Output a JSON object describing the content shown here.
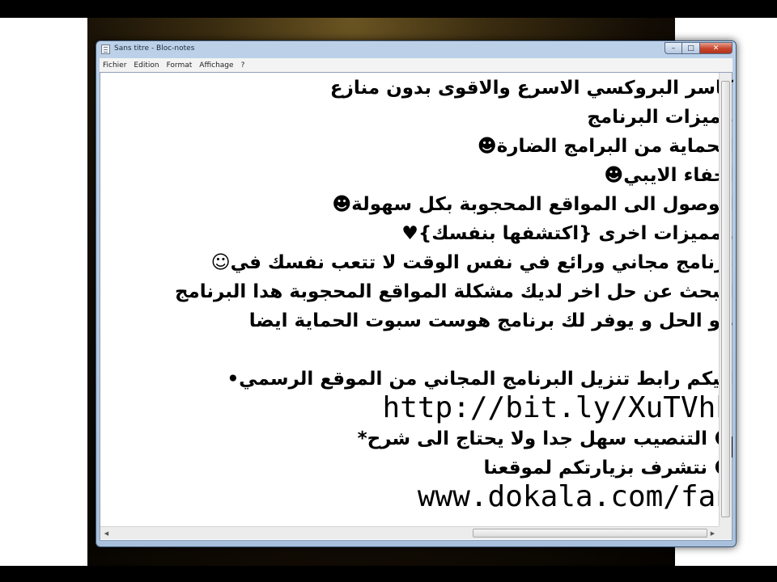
{
  "window": {
    "title": "Sans titre - Bloc-notes",
    "controls": {
      "minimize": "–",
      "maximize": "□",
      "close": "✕"
    }
  },
  "menu": [
    "Fichier",
    "Edition",
    "Format",
    "Affichage",
    "?"
  ],
  "document": {
    "lines": [
      {
        "text": "كاسر البروكسي الاسرع والاقوى بدون منازع",
        "kind": "ar"
      },
      {
        "text": "مميزات البرنامج",
        "kind": "ar"
      },
      {
        "text": "☻الحماية من البرامج   الضارة",
        "kind": "ar"
      },
      {
        "text": "☻اخفاء الايبي",
        "kind": "ar"
      },
      {
        "text": "☻الوصول الى المواقع المحجوبة بكل سهولة",
        "kind": "ar"
      },
      {
        "text": "♥ومميزات اخرى {اكتشفها بنفسك}",
        "kind": "ar"
      },
      {
        "text": "☺برنامج مجاني ورائع في نفس الوقت لا تتعب نفسك في",
        "kind": "ar"
      },
      {
        "text": "البحث عن حل اخر لديك مشكلة المواقع المحجوبة هدا البرنامج",
        "kind": "ar"
      },
      {
        "text": "هو الحل و يوفر لك برنامج هوست سبوت الحماية ايضا",
        "kind": "ar"
      },
      {
        "text": "",
        "kind": "ar"
      },
      {
        "text": "•اليكم رابط تنزيل البرنامج المجاني من الموقع الرسمي",
        "kind": "ar"
      },
      {
        "text": "http://bit.ly/XuTVhb",
        "kind": "en"
      },
      {
        "text": "*التنصيب سهل جدا ولا يحتاج الى شرح ☻",
        "kind": "ar"
      },
      {
        "text": "نتشرف بزيارتكم لموقعنا ☻",
        "kind": "ar"
      },
      {
        "text": "www.dokala.com/fan",
        "kind": "en"
      }
    ]
  }
}
